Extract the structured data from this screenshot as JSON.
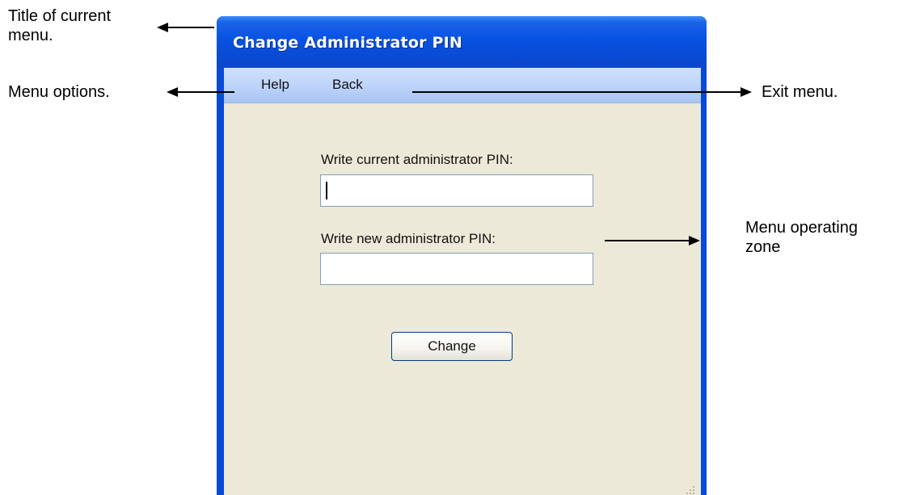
{
  "annotations": {
    "title_note": "Title of current\nmenu.",
    "options_note": "Menu options.",
    "exit_note": "Exit menu.",
    "zone_note": "Menu operating\nzone"
  },
  "window": {
    "title": "Change Administrator PIN",
    "menu": {
      "help_label": "Help",
      "back_label": "Back"
    },
    "form": {
      "current_pin_label": "Write current administrator PIN:",
      "current_pin_value": "",
      "new_pin_label": "Write new administrator PIN:",
      "new_pin_value": "",
      "change_button_label": "Change"
    }
  },
  "colors": {
    "titlebar": "#0852e2",
    "menubar": "#bcd3fa",
    "client_bg": "#ece9d8",
    "input_border": "#7f9db9"
  }
}
